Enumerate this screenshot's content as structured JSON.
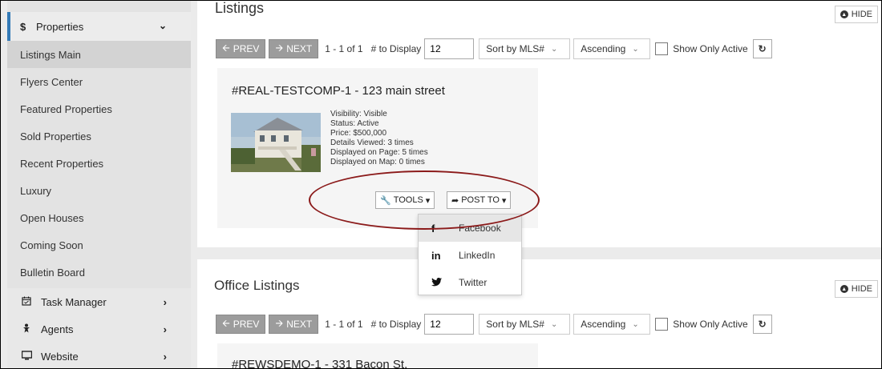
{
  "sidebar": {
    "section": {
      "icon": "dollar-icon",
      "label": "Properties"
    },
    "items": [
      {
        "label": "Listings Main",
        "active": true
      },
      {
        "label": "Flyers Center"
      },
      {
        "label": "Featured Properties"
      },
      {
        "label": "Sold Properties"
      },
      {
        "label": "Recent Properties"
      },
      {
        "label": "Luxury"
      },
      {
        "label": "Open Houses"
      },
      {
        "label": "Coming Soon"
      },
      {
        "label": "Bulletin Board"
      }
    ],
    "menus": [
      {
        "icon": "calendar-icon",
        "label": "Task Manager"
      },
      {
        "icon": "agent-icon",
        "label": "Agents"
      },
      {
        "icon": "monitor-icon",
        "label": "Website"
      }
    ]
  },
  "listings": {
    "title": "Listings",
    "hide_label": "HIDE",
    "prev_label": "PREV",
    "next_label": "NEXT",
    "range_text": "1 - 1 of 1",
    "display_label": "# to Display",
    "display_value": "12",
    "sort_by": "Sort by MLS#",
    "order": "Ascending",
    "show_active_label": "Show Only Active",
    "card": {
      "title": "#REAL-TESTCOMP-1 - 123 main street",
      "details": [
        "Visibility: Visible",
        "Status: Active",
        "Price: $500,000",
        "Details Viewed: 3 times",
        "Displayed on Page: 5 times",
        "Displayed on Map: 0 times"
      ],
      "tools_label": "TOOLS",
      "post_label": "POST TO"
    }
  },
  "post_menu": {
    "items": [
      {
        "icon": "facebook-icon",
        "glyph": "f",
        "label": "Facebook"
      },
      {
        "icon": "linkedin-icon",
        "glyph": "in",
        "label": "LinkedIn"
      },
      {
        "icon": "twitter-icon",
        "glyph": "🐦",
        "label": "Twitter"
      }
    ]
  },
  "office": {
    "title": "Office Listings",
    "hide_label": "HIDE",
    "prev_label": "PREV",
    "next_label": "NEXT",
    "range_text": "1 - 1 of 1",
    "display_label": "# to Display",
    "display_value": "12",
    "sort_by": "Sort by MLS#",
    "order": "Ascending",
    "show_active_label": "Show Only Active",
    "card": {
      "title": "#REWSDEMO-1 - 331 Bacon St."
    }
  },
  "colors": {
    "accent": "#337ab7",
    "highlight": "#8b1a1a"
  }
}
